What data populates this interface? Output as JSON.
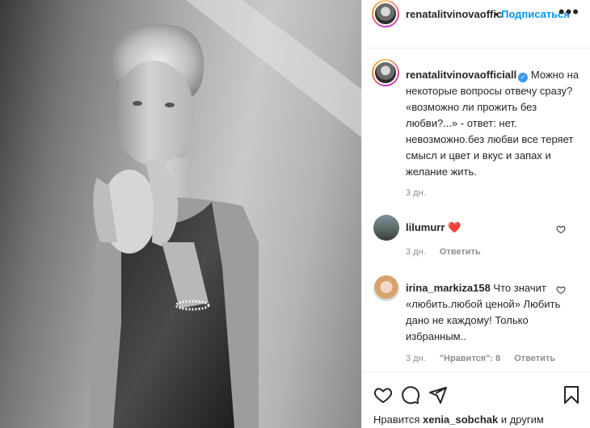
{
  "post": {
    "username": "renatalitvinovaoffic",
    "separator": "•",
    "follow_label": "Подписаться",
    "more_label": "•••"
  },
  "caption": {
    "username": "renatalitvinovaofficiall",
    "verified": true,
    "text": "Можно на некоторые вопросы отвечу сразу? «возможно ли прожить без любви?...» - ответ: нет. невозможно.без любви все теряет смысл и цвет и вкус и запах и желание жить.",
    "time": "3 дн."
  },
  "comments": [
    {
      "username": "lilumurr",
      "text": "❤️",
      "time": "3 дн.",
      "reply_label": "Ответить",
      "likes_label": ""
    },
    {
      "username": "irina_markiza158",
      "text": "Что значит «любить.любой ценой» Любить дано не каждому! Только избранным..",
      "time": "3 дн.",
      "likes_label": "\"Нравится\": 8",
      "reply_label": "Ответить"
    }
  ],
  "likes": {
    "prefix": "Нравится",
    "user": "xenia_sobchak",
    "suffix": "и другим"
  },
  "icons": {
    "like": "heart-icon",
    "comment": "comment-icon",
    "share": "share-icon",
    "save": "bookmark-icon",
    "verified": "verified-badge-icon"
  },
  "colors": {
    "link_blue": "#0095f6",
    "verified_blue": "#3897f0",
    "heart_red": "#ed4956",
    "muted": "#8e8e8e"
  }
}
